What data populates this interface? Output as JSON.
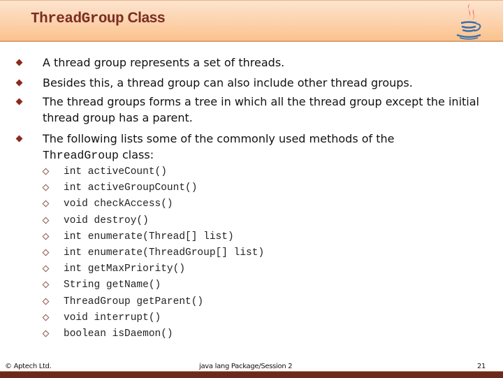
{
  "header": {
    "title_mono": "ThreadGroup",
    "title_sans": " Class",
    "logo_icon": "java-coffee-cup-icon"
  },
  "bullets": [
    {
      "text": "A thread group represents a set of threads."
    },
    {
      "text": "Besides this, a thread group can also include other thread groups."
    },
    {
      "text": "The thread groups forms a tree in which all the thread group except the initial thread group has a parent."
    },
    {
      "text_before": "The following lists some of the commonly used methods of the ",
      "code": "ThreadGroup",
      "text_after": " class:"
    }
  ],
  "methods": [
    "int activeCount()",
    "int activeGroupCount()",
    "void checkAccess()",
    "void destroy()",
    "int enumerate(Thread[] list)",
    "int enumerate(ThreadGroup[] list)",
    "int getMaxPriority()",
    "String getName()",
    "ThreadGroup getParent()",
    "void interrupt()",
    "boolean isDaemon()"
  ],
  "footer": {
    "copyright": "© Aptech Ltd.",
    "session": "java lang Package/Session 2",
    "page_number": "21"
  },
  "colors": {
    "title": "#7a2e22",
    "bullet": "#8b2a1e",
    "header_bg": "#fcd0a8",
    "footer_bar": "#6b2a1c"
  }
}
